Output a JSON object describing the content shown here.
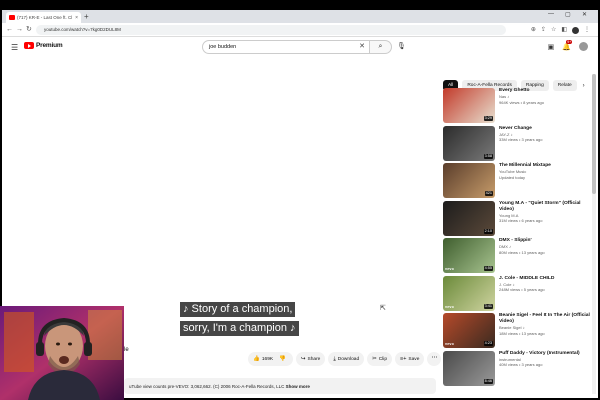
{
  "browser": {
    "tab_title": "(717) KR-E - Last One ft. Cl",
    "tab_close": "×",
    "new_tab": "+",
    "url": "youtube.com/watch?v=7kg0D2DUL8M",
    "win_min": "—",
    "win_max": "▢",
    "win_close": "✕"
  },
  "youtube": {
    "logo_text": "Premium",
    "search_value": "joe budden",
    "notif_count": "9+"
  },
  "player": {
    "subtitle_line1": "♪ Story of a champion,",
    "subtitle_line2": "sorry, I'm a champion ♪"
  },
  "video": {
    "left_fragment": "le",
    "like_count": "169K",
    "share_label": "Share",
    "download_label": "Download",
    "clip_label": "Clip",
    "save_label": "Save",
    "description": "uTube view counts pre-VEVO: 3,062,662. (C) 2006 Roc-A-Fella Records, LLC",
    "show_more": "Show more"
  },
  "chips": [
    "All",
    "Roc-A-Fella Records",
    "Rapping",
    "Relate"
  ],
  "recommendations": [
    {
      "title": "Every Ghetto",
      "channel": "Nas ♪",
      "views": "964K views • 8 years ago",
      "duration": "3:29",
      "colors": [
        "#c23a2a",
        "#e8e0d0"
      ]
    },
    {
      "title": "Never Change",
      "channel": "JAY-Z ♪",
      "views": "33M views • 3 years ago",
      "duration": "3:58",
      "colors": [
        "#2b2b2b",
        "#7a7a7a"
      ]
    },
    {
      "title": "The Millennial Mixtape",
      "channel": "YouTube Music",
      "views": "Updated today",
      "duration": "421",
      "colors": [
        "#5a3d2b",
        "#c79c6a"
      ]
    },
    {
      "title": "Young M.A - \"Quiet Storm\" (Official Video)",
      "channel": "Young M.A",
      "views": "31M views • 6 years ago",
      "duration": "2:10",
      "colors": [
        "#1c1c1c",
        "#5c4a3a"
      ]
    },
    {
      "title": "DMX - Slippin'",
      "channel": "DMX ♪",
      "views": "80M views • 13 years ago",
      "duration": "4:55",
      "colors": [
        "#3f5e2e",
        "#a8c490"
      ]
    },
    {
      "title": "J. Cole - MIDDLE CHILD",
      "channel": "J. Cole ♪",
      "views": "248M views • 5 years ago",
      "duration": "3:41",
      "colors": [
        "#6b8a3a",
        "#cfd4a0"
      ]
    },
    {
      "title": "Beanie Sigel - Feel It In The Air (Official Video)",
      "channel": "Beanie Sigel ♪",
      "views": "18M views • 13 years ago",
      "duration": "4:23",
      "colors": [
        "#b64a2a",
        "#3a2a20"
      ]
    },
    {
      "title": "Puff Daddy - Victory (Instrumental)",
      "channel": "instrumental",
      "views": "40M views • 3 years ago",
      "duration": "8:46",
      "colors": [
        "#4a4a4a",
        "#9a9a9a"
      ]
    }
  ],
  "colors": {
    "yt_red": "#ff0000",
    "chip_active": "#0f0f0f",
    "pill_bg": "#f2f2f2"
  }
}
